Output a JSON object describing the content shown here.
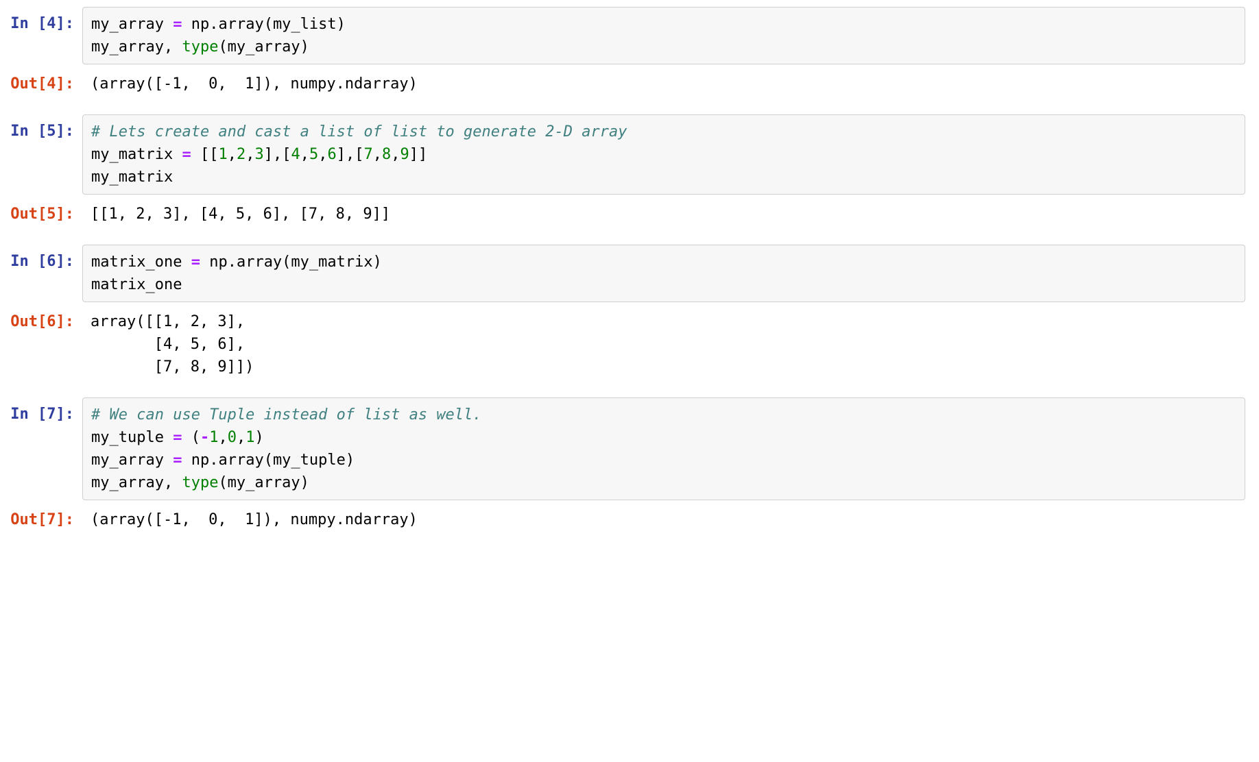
{
  "cells": [
    {
      "in_prompt": "In [4]:",
      "out_prompt": "Out[4]:",
      "code_tokens_lines": [
        [
          {
            "t": "my_array ",
            "c": "var"
          },
          {
            "t": "=",
            "c": "op"
          },
          {
            "t": " np",
            "c": "var"
          },
          {
            "t": ".",
            "c": "var"
          },
          {
            "t": "array(my_list)",
            "c": "var"
          }
        ],
        [
          {
            "t": "my_array, ",
            "c": "var"
          },
          {
            "t": "type",
            "c": "builtin"
          },
          {
            "t": "(my_array)",
            "c": "var"
          }
        ]
      ],
      "output": "(array([-1,  0,  1]), numpy.ndarray)"
    },
    {
      "in_prompt": "In [5]:",
      "out_prompt": "Out[5]:",
      "code_tokens_lines": [
        [
          {
            "t": "# Lets create and cast a list of list to generate 2-D array",
            "c": "comment"
          }
        ],
        [
          {
            "t": "my_matrix ",
            "c": "var"
          },
          {
            "t": "=",
            "c": "op"
          },
          {
            "t": " [[",
            "c": "var"
          },
          {
            "t": "1",
            "c": "num"
          },
          {
            "t": ",",
            "c": "var"
          },
          {
            "t": "2",
            "c": "num"
          },
          {
            "t": ",",
            "c": "var"
          },
          {
            "t": "3",
            "c": "num"
          },
          {
            "t": "],[",
            "c": "var"
          },
          {
            "t": "4",
            "c": "num"
          },
          {
            "t": ",",
            "c": "var"
          },
          {
            "t": "5",
            "c": "num"
          },
          {
            "t": ",",
            "c": "var"
          },
          {
            "t": "6",
            "c": "num"
          },
          {
            "t": "],[",
            "c": "var"
          },
          {
            "t": "7",
            "c": "num"
          },
          {
            "t": ",",
            "c": "var"
          },
          {
            "t": "8",
            "c": "num"
          },
          {
            "t": ",",
            "c": "var"
          },
          {
            "t": "9",
            "c": "num"
          },
          {
            "t": "]]",
            "c": "var"
          }
        ],
        [
          {
            "t": "my_matrix",
            "c": "var"
          }
        ]
      ],
      "output": "[[1, 2, 3], [4, 5, 6], [7, 8, 9]]"
    },
    {
      "in_prompt": "In [6]:",
      "out_prompt": "Out[6]:",
      "code_tokens_lines": [
        [
          {
            "t": "matrix_one ",
            "c": "var"
          },
          {
            "t": "=",
            "c": "op"
          },
          {
            "t": " np",
            "c": "var"
          },
          {
            "t": ".",
            "c": "var"
          },
          {
            "t": "array(my_matrix)",
            "c": "var"
          }
        ],
        [
          {
            "t": "matrix_one",
            "c": "var"
          }
        ]
      ],
      "output": "array([[1, 2, 3],\n       [4, 5, 6],\n       [7, 8, 9]])"
    },
    {
      "in_prompt": "In [7]:",
      "out_prompt": "Out[7]:",
      "code_tokens_lines": [
        [
          {
            "t": "# We can use Tuple instead of list as well.",
            "c": "comment"
          }
        ],
        [
          {
            "t": "my_tuple ",
            "c": "var"
          },
          {
            "t": "=",
            "c": "op"
          },
          {
            "t": " (",
            "c": "var"
          },
          {
            "t": "-",
            "c": "negop"
          },
          {
            "t": "1",
            "c": "num"
          },
          {
            "t": ",",
            "c": "var"
          },
          {
            "t": "0",
            "c": "num"
          },
          {
            "t": ",",
            "c": "var"
          },
          {
            "t": "1",
            "c": "num"
          },
          {
            "t": ")",
            "c": "var"
          }
        ],
        [
          {
            "t": "my_array ",
            "c": "var"
          },
          {
            "t": "=",
            "c": "op"
          },
          {
            "t": " np",
            "c": "var"
          },
          {
            "t": ".",
            "c": "var"
          },
          {
            "t": "array(my_tuple)",
            "c": "var"
          }
        ],
        [
          {
            "t": "my_array, ",
            "c": "var"
          },
          {
            "t": "type",
            "c": "builtin"
          },
          {
            "t": "(my_array)",
            "c": "var"
          }
        ]
      ],
      "output": "(array([-1,  0,  1]), numpy.ndarray)"
    }
  ]
}
